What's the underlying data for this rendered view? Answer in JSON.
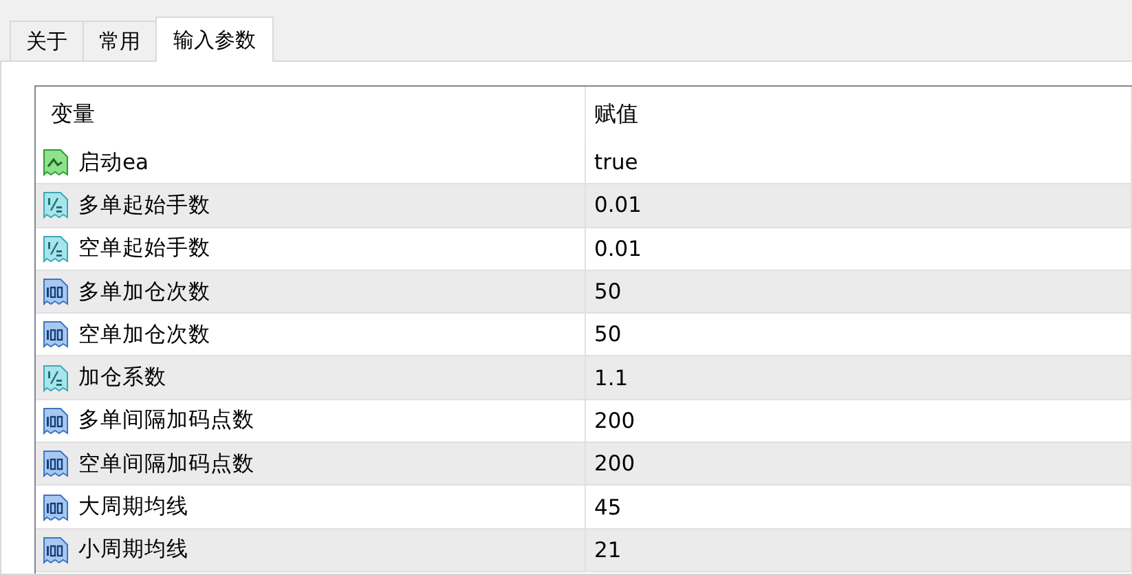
{
  "tabs": [
    {
      "label": "关于",
      "selected": false
    },
    {
      "label": "常用",
      "selected": false
    },
    {
      "label": "输入参数",
      "selected": true
    }
  ],
  "table": {
    "columns": [
      "变量",
      "赋值"
    ],
    "rows": [
      {
        "kind": "bool",
        "name": "启动ea",
        "value": "true"
      },
      {
        "kind": "double",
        "name": "多单起始手数",
        "value": "0.01"
      },
      {
        "kind": "double",
        "name": "空单起始手数",
        "value": "0.01"
      },
      {
        "kind": "int",
        "name": "多单加仓次数",
        "value": "50"
      },
      {
        "kind": "int",
        "name": "空单加仓次数",
        "value": "50"
      },
      {
        "kind": "double",
        "name": "加仓系数",
        "value": "1.1"
      },
      {
        "kind": "int",
        "name": "多单间隔加码点数",
        "value": "200"
      },
      {
        "kind": "int",
        "name": "空单间隔加码点数",
        "value": "200"
      },
      {
        "kind": "int",
        "name": "大周期均线",
        "value": "45"
      },
      {
        "kind": "int",
        "name": "小周期均线",
        "value": "21"
      }
    ]
  }
}
